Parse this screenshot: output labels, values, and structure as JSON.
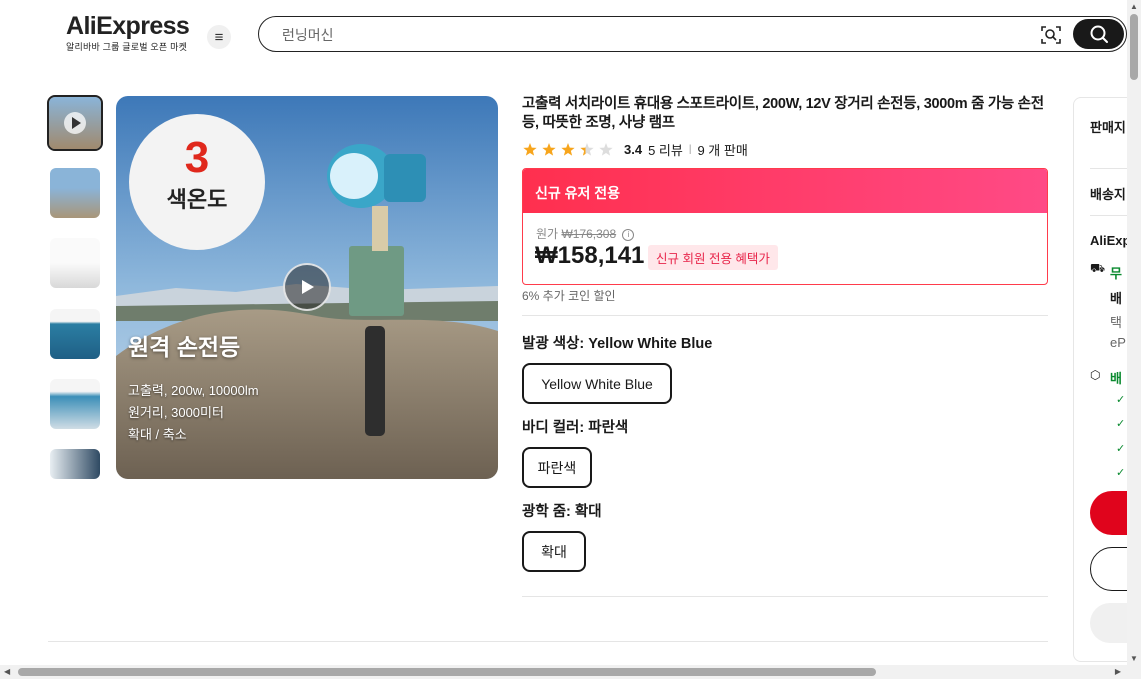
{
  "header": {
    "logo": "AliExpress",
    "logo_sub": "알리바바 그룹 글로벌 오픈 마켓",
    "search_placeholder": "런닝머신"
  },
  "gallery": {
    "badge_number": "3",
    "badge_text": "색온도",
    "image_title": "원격 손전등",
    "image_lines": [
      "고출력, 200w, 10000lm",
      "원거리, 3000미터",
      "확대 / 축소"
    ]
  },
  "product": {
    "title": "고출력 서치라이트 휴대용 스포트라이트, 200W, 12V 장거리 손전등, 3000m 줌 가능 손전등, 따뜻한 조명, 사냥 램프",
    "rating": "3.4",
    "rating_fraction": 0.68,
    "reviews": "5 리뷰",
    "sold": "9 개 판매",
    "promo_header": "신규 유저 전용",
    "original_label": "원가",
    "original_price": "₩176,308",
    "price": "₩158,141",
    "price_tag": "신규 회원 전용 혜택가",
    "coin_discount": "6% 추가 코인 할인",
    "options": [
      {
        "label": "발광 색상: ",
        "value": "Yellow White Blue",
        "button": "Yellow White Blue"
      },
      {
        "label": "바디 컬러: ",
        "value": "파란색",
        "button": "파란색"
      },
      {
        "label": "광학 줌: ",
        "value": "확대",
        "button": "확대"
      }
    ]
  },
  "right_panel": {
    "seller": "판매지",
    "shipping": "배송지",
    "store": "AliExp",
    "free": "무",
    "delivery": "배",
    "carrier": "택",
    "epacket": "eP",
    "service": "배"
  },
  "colors": {
    "brand_red": "#e0041c",
    "promo_gradient_start": "#ff2f4e",
    "promo_gradient_end": "#ff4a86",
    "star": "#f7a51c",
    "green": "#0a8a2f"
  }
}
